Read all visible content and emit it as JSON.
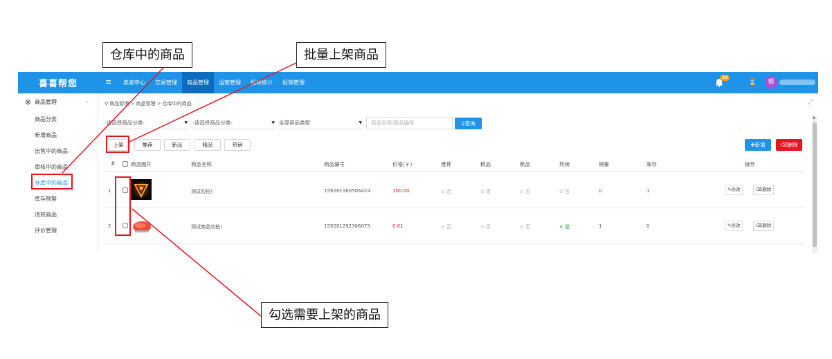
{
  "app": {
    "brand": "喜喜帮您",
    "menu_icon": "hamburger-icon",
    "nav": [
      "卖家中心",
      "交易管理",
      "商品管理",
      "运营管理",
      "报表统计",
      "促销管理"
    ],
    "active_nav": "商品管理",
    "notification_count": "10",
    "avatar_text": "帮",
    "accent": "#1e93e8"
  },
  "sidebar": {
    "section": "商品管理",
    "items": [
      "商品分类",
      "新增商品",
      "出售中的商品",
      "审核中的商品",
      "仓库中的商品",
      "库存预警",
      "违规商品",
      "评价管理"
    ],
    "active_item": "仓库中的商品"
  },
  "breadcrumb": "商品管理 > 商品管理 > 仓库中的商品",
  "filters": {
    "category1": "-请选择商品分类-",
    "category2": "-请选择商品分类-",
    "type": "全部商品类型",
    "search_placeholder": "商品名称/商品编号",
    "query_label": "查询"
  },
  "toolbar": {
    "buttons": [
      "上架",
      "推荐",
      "新品",
      "精品",
      "热销"
    ],
    "add_label": "新增",
    "delete_label": "删除"
  },
  "table": {
    "headers": [
      "#",
      "商品图片",
      "商品名称",
      "商品编号",
      "价格(￥)",
      "推荐",
      "精品",
      "新品",
      "热销",
      "销量",
      "库存",
      "操作"
    ],
    "rows": [
      {
        "index": "1",
        "name": "测试勿拍！",
        "code": "159281160506424",
        "price": "100.00",
        "recommend": "否",
        "fine": "否",
        "new": "否",
        "hot": "否",
        "hot_on": false,
        "sales": "0",
        "stock": "1",
        "edit": "修改",
        "delete": "删除"
      },
      {
        "index": "2",
        "name": "测试商品勿拍！",
        "code": "159281292306075",
        "price": "0.01",
        "recommend": "否",
        "fine": "否",
        "new": "否",
        "hot": "是",
        "hot_on": true,
        "sales": "1",
        "stock": "0",
        "edit": "修改",
        "delete": "删除"
      }
    ]
  },
  "annotations": {
    "warehouse_label": "仓库中的商品",
    "batch_label": "批量上架商品",
    "select_label": "勾选需要上架的商品",
    "highlight_color": "#e8141e"
  }
}
